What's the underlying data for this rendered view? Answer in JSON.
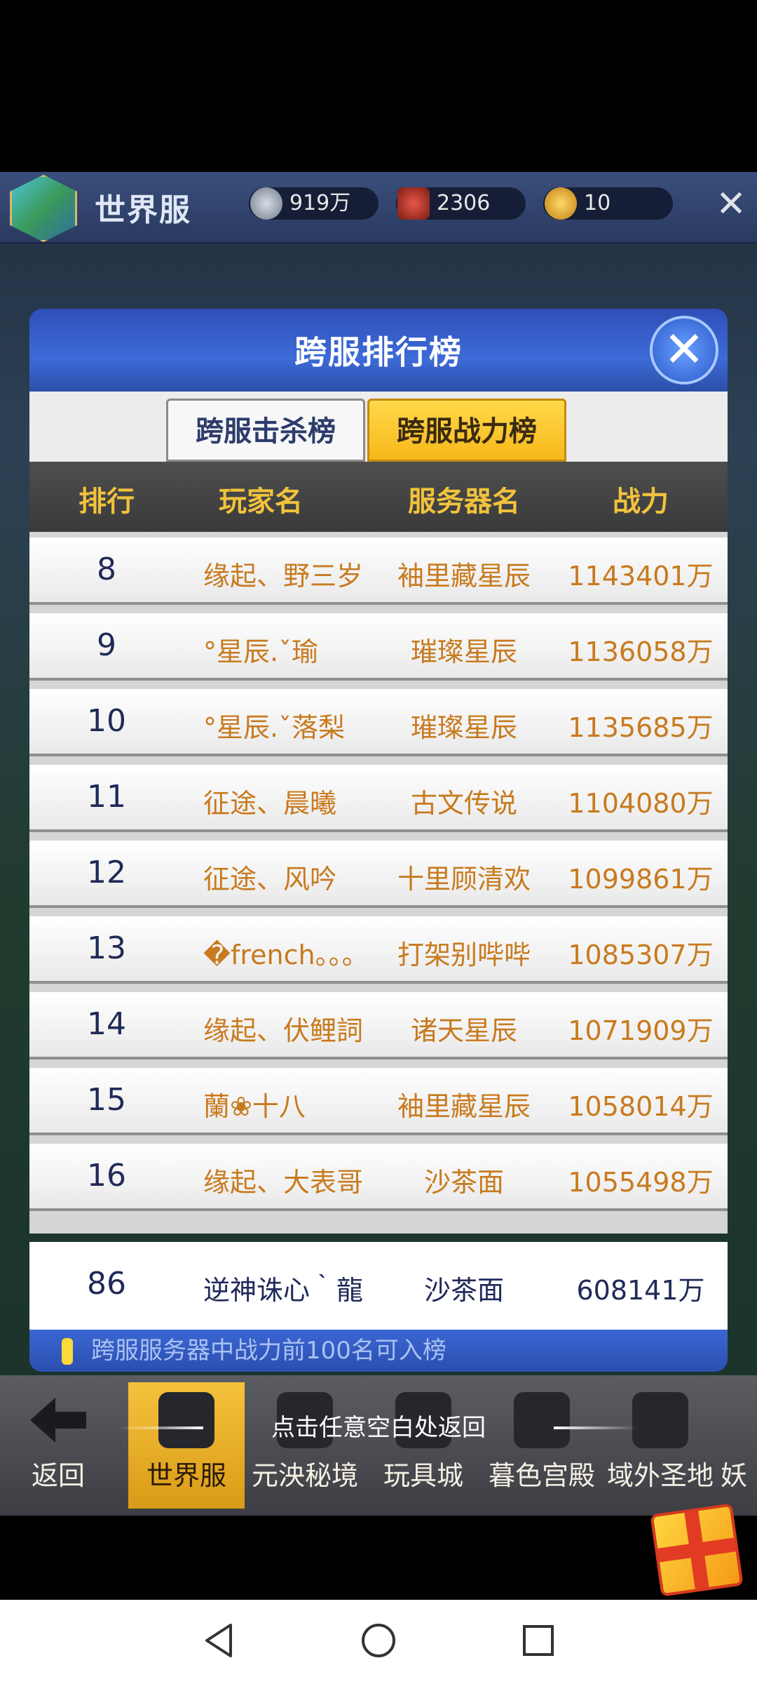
{
  "topbar": {
    "title": "世界服",
    "currencies": [
      {
        "icon": "diamond-coin-icon",
        "value": "919万",
        "color": "#9aa7b8"
      },
      {
        "icon": "hexagon-badge-icon",
        "value": "2306",
        "color": "#c0392b"
      },
      {
        "icon": "gold-coin-icon",
        "value": "10",
        "color": "#e0a21b"
      }
    ]
  },
  "modal": {
    "title": "跨服排行榜",
    "tabs": [
      {
        "label": "跨服击杀榜",
        "active": false
      },
      {
        "label": "跨服战力榜",
        "active": true
      }
    ],
    "columns": [
      "排行",
      "玩家名",
      "服务器名",
      "战力"
    ],
    "rows": [
      {
        "rank": "8",
        "player": "缘起、野三岁",
        "server": "袖里藏星辰",
        "power": "1143401万"
      },
      {
        "rank": "9",
        "player": "°星辰.ˇ瑜",
        "server": "璀璨星辰",
        "power": "1136058万"
      },
      {
        "rank": "10",
        "player": "°星辰.ˇ落梨",
        "server": "璀璨星辰",
        "power": "1135685万"
      },
      {
        "rank": "11",
        "player": "征途、晨曦",
        "server": "古文传说",
        "power": "1104080万"
      },
      {
        "rank": "12",
        "player": "征途、风吟",
        "server": "十里顾清欢",
        "power": "1099861万"
      },
      {
        "rank": "13",
        "player": "�french。。。",
        "server": "打架别哔哔",
        "power": "1085307万"
      },
      {
        "rank": "14",
        "player": "缘起、伏鲤詞",
        "server": "诸天星辰",
        "power": "1071909万"
      },
      {
        "rank": "15",
        "player": "蘭❀十八",
        "server": "袖里藏星辰",
        "power": "1058014万"
      },
      {
        "rank": "16",
        "player": "缘起、大表哥",
        "server": "沙茶面",
        "power": "1055498万"
      }
    ],
    "my_entry": {
      "rank": "86",
      "player": "逆神诛心｀龍",
      "server": "沙茶面",
      "power": "608141万"
    },
    "footer_note": "跨服服务器中战力前100名可入榜"
  },
  "hint": "点击任意空白处返回",
  "bottom_nav": [
    {
      "label": "返回",
      "icon": "back-arrow-icon",
      "active": false
    },
    {
      "label": "世界服",
      "icon": "world-server-icon",
      "active": true
    },
    {
      "label": "元泱秘境",
      "icon": "secret-realm-icon",
      "active": false
    },
    {
      "label": "玩具城",
      "icon": "toy-castle-icon",
      "active": false
    },
    {
      "label": "暮色宫殿",
      "icon": "twilight-palace-icon",
      "active": false
    },
    {
      "label": "域外圣地",
      "icon": "holy-land-icon",
      "active": false
    },
    {
      "label": "妖",
      "icon": "demon-icon",
      "active": false
    }
  ]
}
